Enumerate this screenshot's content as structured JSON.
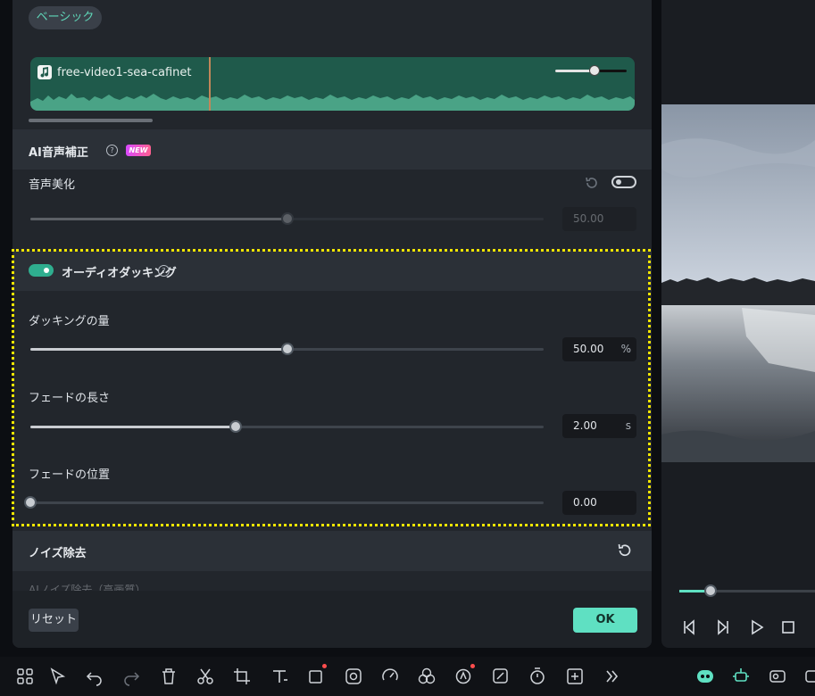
{
  "tabs": {
    "basic": "ベーシック"
  },
  "clip": {
    "name": "free-video1-sea-cafinet",
    "volume": 0.55
  },
  "ai_voice": {
    "title": "AI音声補正",
    "badge": "NEW",
    "beautify_label": "音声美化",
    "beautify_value": "50.00",
    "beautify_level": 0.5,
    "beautify_enabled": false
  },
  "ducking": {
    "title": "オーディオダッキング",
    "enabled": true,
    "amount": {
      "label": "ダッキングの量",
      "value": "50.00",
      "unit": "%",
      "level": 0.5
    },
    "fade_length": {
      "label": "フェードの長さ",
      "value": "2.00",
      "unit": "s",
      "level": 0.4
    },
    "fade_position": {
      "label": "フェードの位置",
      "value": "0.00",
      "unit": "",
      "level": 0.0
    }
  },
  "noise": {
    "title": "ノイズ除去",
    "item_label": "AIノイズ除去（高画質）"
  },
  "footer": {
    "reset_label": "リセット",
    "ok_label": "OK"
  },
  "preview": {
    "progress": 0.23
  },
  "colors": {
    "accent": "#5fe0c2",
    "highlight": "#f2e600",
    "clip": "#1f5a4b",
    "panel": "#22262c"
  },
  "toolbar_icons": [
    "grid-icon",
    "select-icon",
    "undo-icon",
    "redo-icon",
    "delete-icon",
    "cut-icon",
    "crop-icon",
    "text-icon",
    "shape-icon",
    "mask-icon",
    "speed-icon",
    "color-icon",
    "ai-icon",
    "ai-edit-icon",
    "timer-icon",
    "add-icon",
    "more-icon",
    "mascot-icon",
    "ai-sparkle-icon",
    "ai-motion-icon"
  ]
}
